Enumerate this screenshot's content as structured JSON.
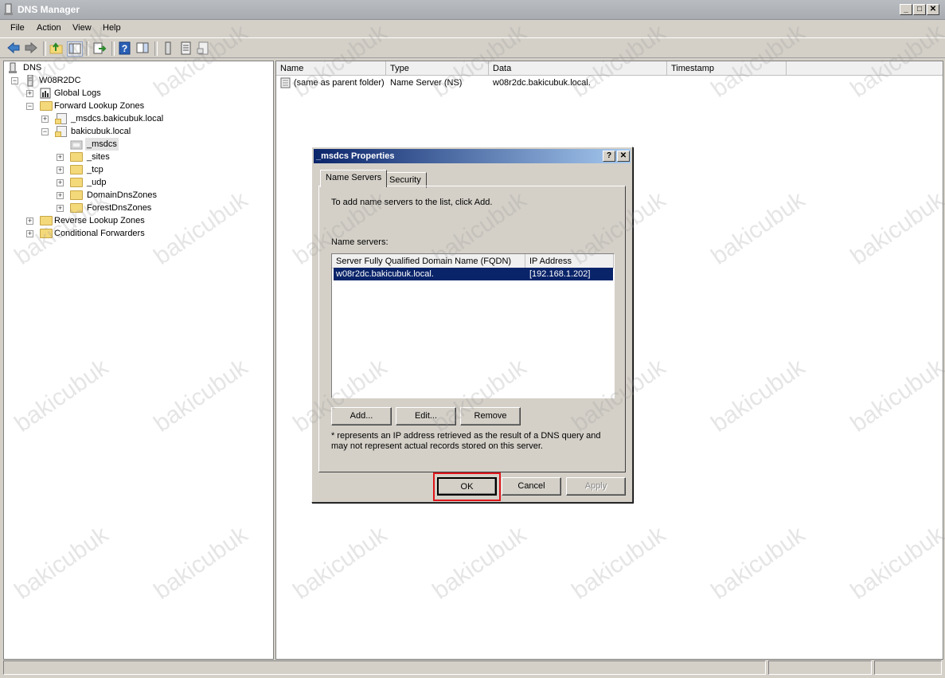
{
  "window": {
    "title": "DNS Manager",
    "controls": [
      "_",
      "□",
      "✕"
    ]
  },
  "menu": [
    "File",
    "Action",
    "View",
    "Help"
  ],
  "tree": {
    "root": "DNS",
    "server": "W08R2DC",
    "global_logs": "Global Logs",
    "forward_zones": "Forward Lookup Zones",
    "msdcs_zone": "_msdcs.bakicubuk.local",
    "domain_zone": "bakicubuk.local",
    "msdcs": "_msdcs",
    "sites": "_sites",
    "tcp": "_tcp",
    "udp": "_udp",
    "domain_dns_zones": "DomainDnsZones",
    "forest_dns_zones": "ForestDnsZones",
    "reverse_zones": "Reverse Lookup Zones",
    "conditional_forwarders": "Conditional Forwarders"
  },
  "list": {
    "columns": [
      "Name",
      "Type",
      "Data",
      "Timestamp"
    ],
    "rows": [
      {
        "name": "(same as parent folder)",
        "type": "Name Server (NS)",
        "data": "w08r2dc.bakicubuk.local.",
        "timestamp": ""
      }
    ]
  },
  "dialog": {
    "title": "_msdcs Properties",
    "help_button": "?",
    "close_button": "✕",
    "tabs": [
      "Name Servers",
      "Security"
    ],
    "instruction": "To add name servers to the list, click Add.",
    "name_servers_label": "Name servers:",
    "ns_columns": [
      "Server Fully Qualified Domain Name (FQDN)",
      "IP Address"
    ],
    "ns_rows": [
      {
        "fqdn": "w08r2dc.bakicubuk.local.",
        "ip": "[192.168.1.202]"
      }
    ],
    "add": "Add...",
    "edit": "Edit...",
    "remove": "Remove",
    "note": "* represents an IP address retrieved as the result of a DNS query and may not represent actual records stored on this server.",
    "ok": "OK",
    "cancel": "Cancel",
    "apply": "Apply"
  },
  "colors": {
    "selection": "#0a246a",
    "highlight_box": "#e0151b",
    "title_gradient_start": "#0a246a"
  },
  "watermark": "bakicubuk"
}
